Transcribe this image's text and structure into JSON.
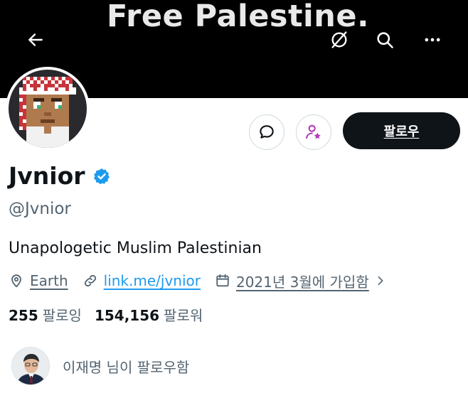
{
  "banner": {
    "title": "Free Palestine."
  },
  "header_icons": [
    "back-arrow-icon",
    "block-bell-icon",
    "search-icon",
    "more-icon"
  ],
  "profile": {
    "display_name": "Jvnior",
    "verified_icon": "verified-badge-icon",
    "handle": "@Jvnior",
    "bio": "Unapologetic Muslim Palestinian",
    "location": "Earth",
    "link": "link.me/jvnior",
    "joined": "2021년 3월에 가입함"
  },
  "actions": {
    "follow_label": "팔로우"
  },
  "stats": {
    "following_count": "255",
    "following_label": "팔로잉",
    "followers_count": "154,156",
    "followers_label": "팔로워"
  },
  "followed_by": {
    "text": "이재명 님이 팔로우함"
  },
  "colors": {
    "banner": "#000000",
    "text_primary": "#0f1419",
    "text_secondary": "#536471",
    "link": "#1d9bf0",
    "verified": "#1d9bf0",
    "follow_button": "#0f1419",
    "subscribe_icon": "#b13bb5"
  }
}
